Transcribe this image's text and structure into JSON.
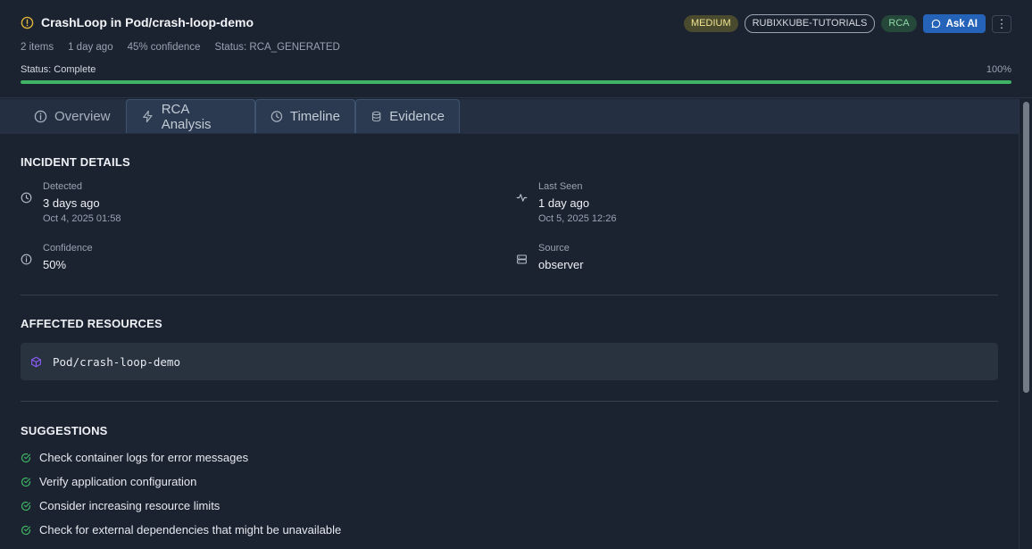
{
  "header": {
    "title": "CrashLoop in Pod/crash-loop-demo",
    "meta": [
      "2 items",
      "1 day ago",
      "45% confidence",
      "Status: RCA_GENERATED"
    ],
    "status_label": "Status: Complete",
    "progress_label": "100%",
    "progress": 1.0
  },
  "badges": {
    "severity": "MEDIUM",
    "namespace": "RUBIXKUBE-TUTORIALS",
    "type": "RCA"
  },
  "actions": {
    "ask_ai": "Ask AI",
    "more": "⋮"
  },
  "tabs": [
    {
      "label": "Overview",
      "icon": "info-icon"
    },
    {
      "label": "RCA Analysis",
      "icon": "bolt-icon"
    },
    {
      "label": "Timeline",
      "icon": "clock-icon"
    },
    {
      "label": "Evidence",
      "icon": "database-icon"
    }
  ],
  "incident": {
    "title": "INCIDENT DETAILS",
    "detected": {
      "label": "Detected",
      "value": "3 days ago",
      "sub": "Oct 4, 2025 01:58"
    },
    "last_seen": {
      "label": "Last Seen",
      "value": "1 day ago",
      "sub": "Oct 5, 2025 12:26"
    },
    "confidence": {
      "label": "Confidence",
      "value": "50%"
    },
    "source": {
      "label": "Source",
      "value": "observer"
    }
  },
  "affected": {
    "title": "AFFECTED RESOURCES",
    "resources": [
      "Pod/crash-loop-demo"
    ]
  },
  "suggestions": {
    "title": "SUGGESTIONS",
    "items": [
      "Check container logs for error messages",
      "Verify application configuration",
      "Consider increasing resource limits",
      "Check for external dependencies that might be unavailable"
    ]
  },
  "colors": {
    "background": "#1b2230",
    "accent": "#2563b8",
    "success": "#3fb464",
    "warning": "#e0b43a",
    "resource_icon": "#8b5cf6"
  }
}
